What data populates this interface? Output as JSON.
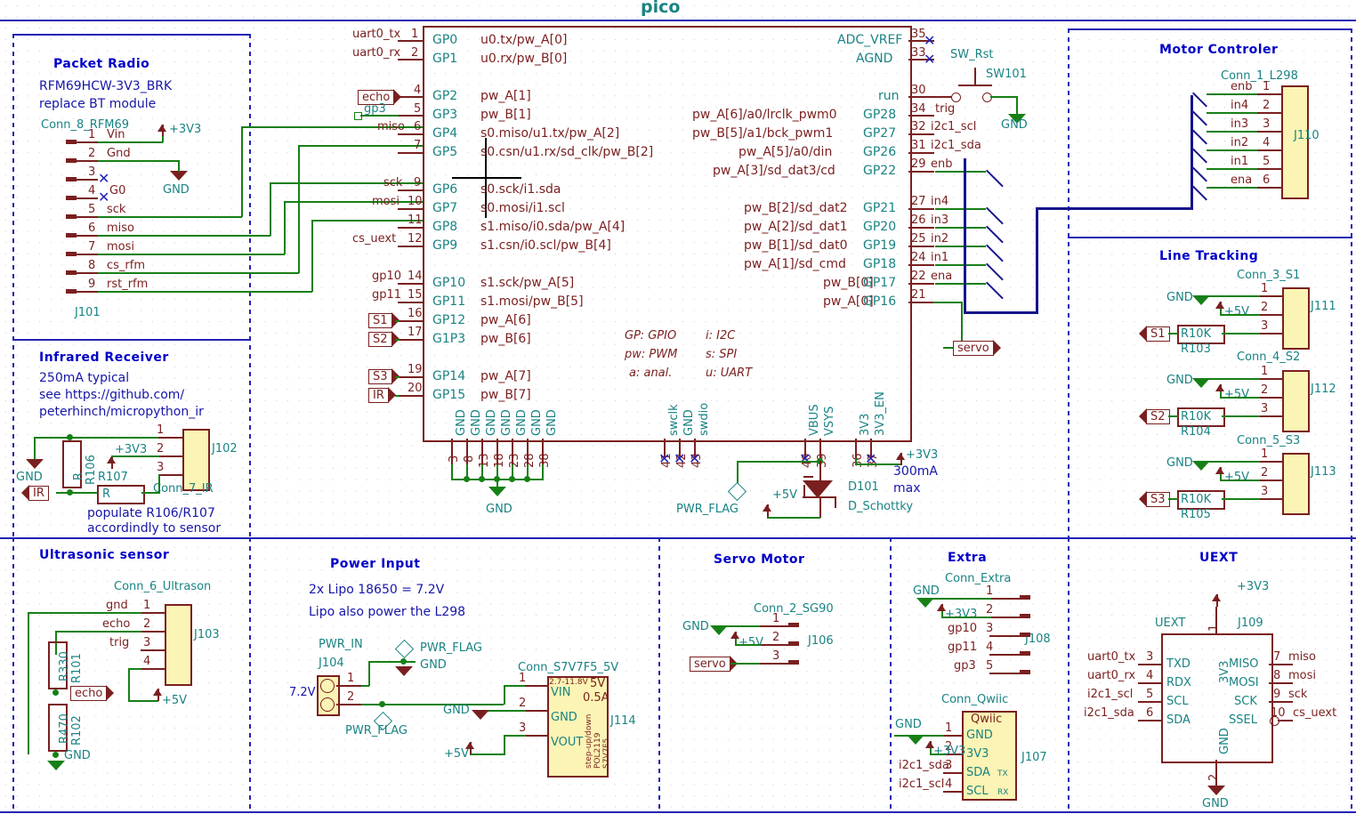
{
  "sheet": {
    "title": "pico"
  },
  "sections": {
    "packet_radio": {
      "title": "Packet Radio",
      "notes": [
        "RFM69HCW-3V3_BRK",
        "replace BT module"
      ],
      "conn_name": "Conn_8_RFM69",
      "ref": "J101",
      "power": "+3V3",
      "gnd": "GND",
      "pins": [
        {
          "num": "1",
          "name": "Vin"
        },
        {
          "num": "2",
          "name": "Gnd"
        },
        {
          "num": "3",
          "name": ""
        },
        {
          "num": "4",
          "name": "G0"
        },
        {
          "num": "5",
          "name": "sck"
        },
        {
          "num": "6",
          "name": "miso"
        },
        {
          "num": "7",
          "name": "mosi"
        },
        {
          "num": "8",
          "name": "cs_rfm"
        },
        {
          "num": "9",
          "name": "rst_rfm"
        }
      ]
    },
    "infrared": {
      "title": "Infrared Receiver",
      "notes": [
        "250mA typical",
        "see https://github.com/",
        "peterhinch/micropython_ir"
      ],
      "footer": [
        "populate R106/R107",
        "accordindly to sensor"
      ],
      "conn_name": "Conn_7_IR",
      "ref": "J102",
      "r1_ref": "R106",
      "r1_val": "R",
      "r2_ref": "R107",
      "r2_val": "R",
      "power": "+3V3",
      "gnd": "GND",
      "signal": "IR",
      "pins": [
        {
          "num": "1"
        },
        {
          "num": "2"
        },
        {
          "num": "3"
        }
      ]
    },
    "ultrasonic": {
      "title": "Ultrasonic sensor",
      "conn_name": "Conn_6_Ultrason",
      "ref": "J103",
      "power": "+5V",
      "gnd": "GND",
      "signal": "echo",
      "r1_ref": "R101",
      "r1_val": "R330",
      "r2_ref": "R102",
      "r2_val": "R470",
      "pins": [
        {
          "num": "1",
          "name": "gnd"
        },
        {
          "num": "2",
          "name": "echo"
        },
        {
          "num": "3",
          "name": "trig"
        },
        {
          "num": "4",
          "name": ""
        }
      ]
    },
    "power_input": {
      "title": "Power Input",
      "notes": [
        "2x Lipo 18650 = 7.2V",
        "Lipo also power the L298"
      ],
      "conn_name": "PWR_IN",
      "ref": "J104",
      "voltage": "7.2V",
      "flag1": "PWR_FLAG",
      "flag2": "PWR_FLAG",
      "gnd1": "GND",
      "gnd2": "GND",
      "out": "+5V",
      "reg_name": "Conn_S7V7F5_5V",
      "reg_ref": "J114",
      "reg_top_left": "2.7-11.8V",
      "reg_top_right": "5V",
      "reg_amp": "0.5A",
      "reg_vert": [
        "step-up/down",
        "POL2119",
        "S7V7F5"
      ],
      "reg_pins": [
        {
          "num": "1",
          "name": "VIN"
        },
        {
          "num": "2",
          "name": "GND"
        },
        {
          "num": "3",
          "name": "VOUT"
        }
      ]
    },
    "servo": {
      "title": "Servo Motor",
      "conn_name": "Conn_2_SG90",
      "ref": "J106",
      "gnd": "GND",
      "power": "+5V",
      "signal": "servo",
      "pins": [
        {
          "num": "1"
        },
        {
          "num": "2"
        },
        {
          "num": "3"
        }
      ]
    },
    "extra": {
      "title": "Extra",
      "conn_name": "Conn_Extra",
      "ref": "J108",
      "gnd": "GND",
      "power": "+3V3",
      "pins": [
        {
          "num": "1",
          "name": ""
        },
        {
          "num": "2",
          "name": ""
        },
        {
          "num": "3",
          "name": "gp10"
        },
        {
          "num": "4",
          "name": "gp11"
        },
        {
          "num": "5",
          "name": "gp3"
        }
      ],
      "qwiic_name": "Conn_Qwiic",
      "qwiic_ref": "J107",
      "qwiic_title": "Qwiic",
      "qwiic_gnd": "GND",
      "qwiic_power": "+3V3",
      "qwiic_pins": [
        {
          "num": "1",
          "label": "GND",
          "net": "",
          "sub": ""
        },
        {
          "num": "2",
          "label": "3V3",
          "net": "",
          "sub": ""
        },
        {
          "num": "3",
          "label": "SDA",
          "net": "i2c1_sda",
          "sub": "TX"
        },
        {
          "num": "4",
          "label": "SCL",
          "net": "i2c1_scl",
          "sub": "RX"
        }
      ]
    },
    "uext": {
      "title": "UEXT",
      "chip_name": "UEXT",
      "ref": "J109",
      "power": "+3V3",
      "gnd": "GND",
      "top_pin": {
        "num": "1",
        "name": "3V3"
      },
      "bottom_pin": {
        "num": "2",
        "name": "GND"
      },
      "left_pins": [
        {
          "num": "3",
          "name": "TXD",
          "net": "uart0_tx"
        },
        {
          "num": "4",
          "name": "RDX",
          "net": "uart0_rx"
        },
        {
          "num": "5",
          "name": "SCL",
          "net": "i2c1_scl"
        },
        {
          "num": "6",
          "name": "SDA",
          "net": "i2c1_sda"
        }
      ],
      "right_pins": [
        {
          "num": "7",
          "name": "MISO",
          "net": "miso"
        },
        {
          "num": "8",
          "name": "MOSI",
          "net": "mosi"
        },
        {
          "num": "9",
          "name": "SCK",
          "net": "sck"
        },
        {
          "num": "10",
          "name": "SSEL",
          "net": "cs_uext"
        }
      ]
    },
    "motor": {
      "title": "Motor Controler",
      "conn_name": "Conn_1_L298",
      "ref": "J110",
      "pins": [
        {
          "num": "1",
          "name": "enb"
        },
        {
          "num": "2",
          "name": "in4"
        },
        {
          "num": "3",
          "name": "in3"
        },
        {
          "num": "4",
          "name": "in2"
        },
        {
          "num": "5",
          "name": "in1"
        },
        {
          "num": "6",
          "name": "ena"
        }
      ]
    },
    "line_tracking": {
      "title": "Line Tracking",
      "groups": [
        {
          "conn_name": "Conn_3_S1",
          "ref": "J111",
          "res_ref": "R103",
          "res_val": "R10K",
          "signal": "S1",
          "gnd": "GND",
          "power": "+5V",
          "pins": [
            {
              "num": "1"
            },
            {
              "num": "2"
            },
            {
              "num": "3"
            }
          ]
        },
        {
          "conn_name": "Conn_4_S2",
          "ref": "J112",
          "res_ref": "R104",
          "res_val": "R10K",
          "signal": "S2",
          "gnd": "GND",
          "power": "+5V",
          "pins": [
            {
              "num": "1"
            },
            {
              "num": "2"
            },
            {
              "num": "3"
            }
          ]
        },
        {
          "conn_name": "Conn_5_S3",
          "ref": "J113",
          "res_ref": "R105",
          "res_val": "R10K",
          "signal": "S3",
          "gnd": "GND",
          "power": "+5V",
          "pins": [
            {
              "num": "1"
            },
            {
              "num": "2"
            },
            {
              "num": "3"
            }
          ]
        }
      ]
    },
    "reset": {
      "label": "SW_Rst",
      "ref": "SW101",
      "gnd": "GND"
    },
    "schottky": {
      "ref": "D101",
      "val": "D_Schottky",
      "flag": "PWR_FLAG",
      "net5v": "+5V",
      "net3v3": "+3V3",
      "note1": "300mA",
      "note2": "max"
    },
    "gnd_bus": {
      "label": "GND"
    }
  },
  "pico": {
    "legend": [
      {
        "l": "GP: GPIO",
        "r": "i: I2C"
      },
      {
        "l": "pw: PWM",
        "r": "s: SPI"
      },
      {
        "l": "a: anal.",
        "r": "u: UART"
      }
    ],
    "left_pins": [
      {
        "num": "1",
        "gp": "GP0",
        "fn": "u0.tx/pw_A[0]",
        "net": "uart0_tx",
        "nettype": "plain"
      },
      {
        "num": "2",
        "gp": "GP1",
        "fn": "u0.rx/pw_B[0]",
        "net": "uart0_rx",
        "nettype": "plain"
      },
      {
        "num": "4",
        "gp": "GP2",
        "fn": "pw_A[1]",
        "net": "echo",
        "nettype": "label-in"
      },
      {
        "num": "5",
        "gp": "GP3",
        "fn": "pw_B[1]",
        "net": "gp3",
        "nettype": "tag"
      },
      {
        "num": "6",
        "gp": "GP4",
        "fn": "s0.miso/u1.tx/pw_A[2]",
        "net": "miso",
        "nettype": "plain"
      },
      {
        "num": "7",
        "gp": "GP5",
        "fn": "s0.csn/u1.rx/sd_clk/pw_B[2]",
        "net": "",
        "nettype": "plain"
      },
      {
        "num": "9",
        "gp": "GP6",
        "fn": "s0.sck/i1.sda",
        "net": "sck",
        "nettype": "plain"
      },
      {
        "num": "10",
        "gp": "GP7",
        "fn": "s0.mosi/i1.scl",
        "net": "mosi",
        "nettype": "plain"
      },
      {
        "num": "11",
        "gp": "GP8",
        "fn": "s1.miso/i0.sda/pw_A[4]",
        "net": "",
        "nettype": "plain"
      },
      {
        "num": "12",
        "gp": "GP9",
        "fn": "s1.csn/i0.scl/pw_B[4]",
        "net": "cs_uext",
        "nettype": "plain"
      },
      {
        "num": "14",
        "gp": "GP10",
        "fn": "s1.sck/pw_A[5]",
        "net": "gp10",
        "nettype": "plain"
      },
      {
        "num": "15",
        "gp": "GP11",
        "fn": "s1.mosi/pw_B[5]",
        "net": "gp11",
        "nettype": "plain"
      },
      {
        "num": "16",
        "gp": "GP12",
        "fn": "pw_A[6]",
        "net": "S1",
        "nettype": "label-in"
      },
      {
        "num": "17",
        "gp": "G1P3",
        "fn": "pw_B[6]",
        "net": "S2",
        "nettype": "label-in"
      },
      {
        "num": "19",
        "gp": "GP14",
        "fn": "pw_A[7]",
        "net": "S3",
        "nettype": "label-in"
      },
      {
        "num": "20",
        "gp": "GP15",
        "fn": "pw_B[7]",
        "net": "IR",
        "nettype": "label-in"
      }
    ],
    "right_pins": [
      {
        "num": "35",
        "gp": "ADC_VREF",
        "fn": "",
        "net": "",
        "nc": true
      },
      {
        "num": "33",
        "gp": "AGND",
        "fn": "",
        "net": "",
        "nc": true
      },
      {
        "num": "30",
        "gp": "run",
        "fn": "",
        "net": "",
        "nc": false
      },
      {
        "num": "34",
        "gp": "GP28",
        "fn": "pw_A[6]/a0/lrclk_pwm0",
        "net": "trig",
        "nc": false
      },
      {
        "num": "32",
        "gp": "GP27",
        "fn": "pw_B[5]/a1/bck_pwm1",
        "net": "i2c1_scl",
        "nc": false
      },
      {
        "num": "31",
        "gp": "GP26",
        "fn": "pw_A[5]/a0/din",
        "net": "i2c1_sda",
        "nc": false
      },
      {
        "num": "29",
        "gp": "GP22",
        "fn": "pw_A[3]/sd_dat3/cd",
        "net": "enb",
        "nc": false
      },
      {
        "num": "27",
        "gp": "GP21",
        "fn": "pw_B[2]/sd_dat2",
        "net": "in4",
        "nc": false
      },
      {
        "num": "26",
        "gp": "GP20",
        "fn": "pw_A[2]/sd_dat1",
        "net": "in3",
        "nc": false
      },
      {
        "num": "25",
        "gp": "GP19",
        "fn": "pw_B[1]/sd_dat0",
        "net": "in2",
        "nc": false
      },
      {
        "num": "24",
        "gp": "GP18",
        "fn": "pw_A[1]/sd_cmd",
        "net": "in1",
        "nc": false
      },
      {
        "num": "22",
        "gp": "GP17",
        "fn": "pw_B[0]",
        "net": "ena",
        "nc": false
      },
      {
        "num": "21",
        "gp": "GP16",
        "fn": "pw_A[0]",
        "net": "",
        "nc": false
      }
    ],
    "bottom_gnd": [
      {
        "num": "3",
        "name": "GND"
      },
      {
        "num": "8",
        "name": "GND"
      },
      {
        "num": "13",
        "name": "GND"
      },
      {
        "num": "18",
        "name": "GND"
      },
      {
        "num": "23",
        "name": "GND"
      },
      {
        "num": "28",
        "name": "GND"
      },
      {
        "num": "38",
        "name": "GND"
      }
    ],
    "bottom_misc": [
      {
        "num": "41",
        "name": "swclk",
        "nc": true
      },
      {
        "num": "42",
        "name": "GND",
        "nc": true
      },
      {
        "num": "43",
        "name": "swdio",
        "nc": true
      },
      {
        "num": "40",
        "name": "VBUS",
        "nc": true
      },
      {
        "num": "39",
        "name": "VSYS",
        "nc": false
      },
      {
        "num": "36",
        "name": "3V3",
        "nc": false
      },
      {
        "num": "37",
        "name": "3V3_EN",
        "nc": true
      }
    ]
  },
  "colors": {
    "teal": "#1a8383",
    "red": "#7a1f1f",
    "blue": "#1616a8",
    "green": "#168016",
    "navy": "#16168c",
    "connector_fill": "#fbf4b4"
  }
}
